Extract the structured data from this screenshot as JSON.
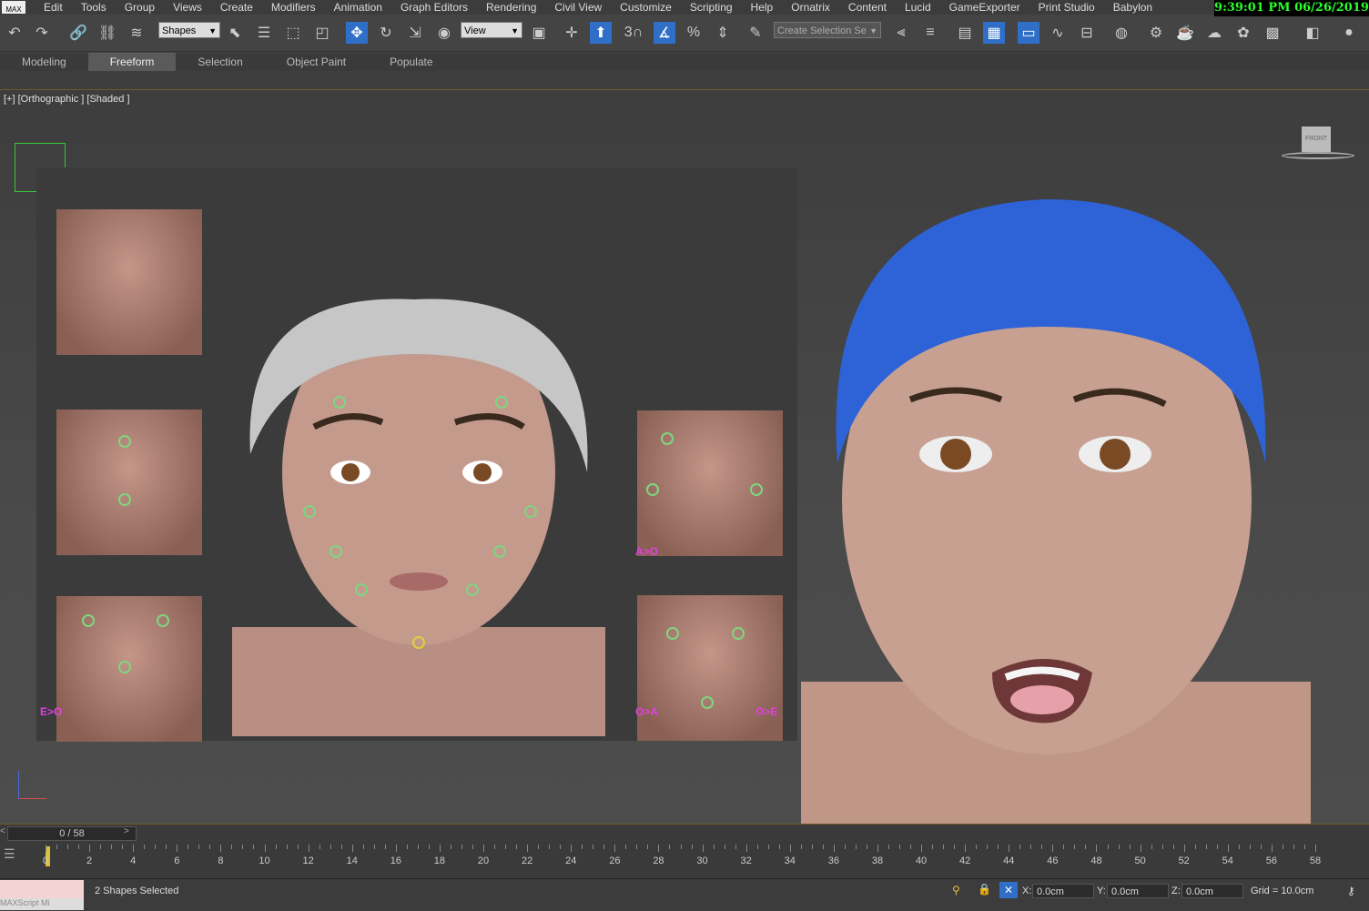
{
  "app": {
    "logo": "MAX"
  },
  "clock": "9:39:01 PM 06/26/2019",
  "menu": [
    "Edit",
    "Tools",
    "Group",
    "Views",
    "Create",
    "Modifiers",
    "Animation",
    "Graph Editors",
    "Rendering",
    "Civil View",
    "Customize",
    "Scripting",
    "Help",
    "Ornatrix",
    "Content",
    "Lucid",
    "GameExporter",
    "Print Studio",
    "Babylon"
  ],
  "toolbar": {
    "selection_filter": "Shapes",
    "ref_coord": "View",
    "named_selection_placeholder": "Create Selection Se",
    "snap_value": "3"
  },
  "ribbon_tabs": [
    "Modeling",
    "Freeform",
    "Selection",
    "Object Paint",
    "Populate"
  ],
  "ribbon_active": "Freeform",
  "viewport": {
    "label": "[+] [Orthographic ] [Shaded ]",
    "viewcube": "FRONT"
  },
  "labels": {
    "tongue_l": "E>O",
    "tongue_r": "O>A",
    "tongue_r2": "O>E",
    "mouth_tag": "A>O"
  },
  "timeline": {
    "frame_display": "0 / 58",
    "ticks": [
      "0",
      "2",
      "4",
      "6",
      "8",
      "10",
      "12",
      "14",
      "16",
      "18",
      "20",
      "22",
      "24",
      "26",
      "28",
      "30",
      "32",
      "34",
      "36",
      "38",
      "40",
      "42",
      "44",
      "46",
      "48",
      "50",
      "52",
      "54",
      "56",
      "58"
    ]
  },
  "status": {
    "selection": "2 Shapes Selected",
    "x_label": "X:",
    "x": "0.0cm",
    "y_label": "Y:",
    "y": "0.0cm",
    "z_label": "Z:",
    "z": "0.0cm",
    "grid": "Grid = 10.0cm",
    "listener": "MAXScript Mi"
  },
  "colors": {
    "accent": "#2f6fc7",
    "hair_blue": "#2e63d8",
    "control": "#7fd67f",
    "clock": "#2bff2b"
  }
}
